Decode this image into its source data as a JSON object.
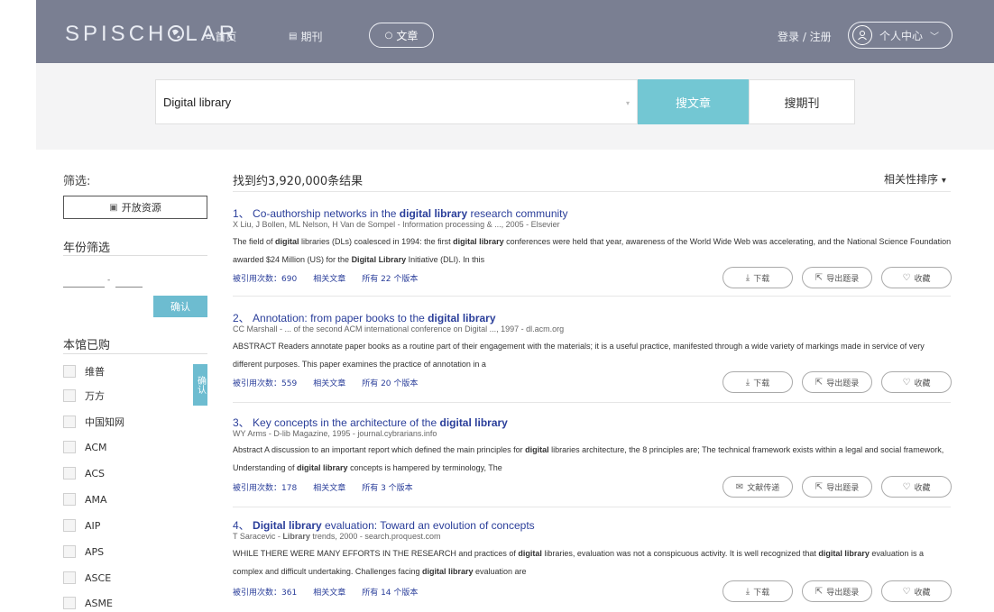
{
  "header": {
    "logo_text": "SPISCH",
    "logo_text_after": "LAR",
    "nav": [
      {
        "icon": "home-icon",
        "label": "首页"
      },
      {
        "icon": "journal-icon",
        "label": "期刊"
      }
    ],
    "search_tab": "文章",
    "login_register": "登录 / 注册",
    "user_center": "个人中心"
  },
  "search": {
    "value": "Digital library",
    "btn_article": "搜文章",
    "btn_journal": "搜期刊"
  },
  "sidebar": {
    "filter_title": "筛选:",
    "open_resources": "开放资源",
    "year_filter_title": "年份筛选",
    "year_dash": "-",
    "confirm": "确认",
    "library_title": "本馆已购",
    "library_confirm": "确认",
    "libraries": [
      "维普",
      "万方",
      "中国知网",
      "ACM",
      "ACS",
      "AMA",
      "AIP",
      "APS",
      "ASCE",
      "ASME"
    ]
  },
  "results": {
    "count": "找到约3,920,000条结果",
    "sort": "相关性排序",
    "items": [
      {
        "num": "1、",
        "title_pre": "Co-authorship networks in the ",
        "title_bold": "digital library",
        "title_post": " research community",
        "authors": "X Liu, J Bollen, ML Nelson, H Van de Sompel - Information processing & ..., 2005 - Elsevier",
        "abstract": "The field of <b>digital</b> libraries (DLs) coalesced in 1994: the first <b>digital library</b> conferences were held that year, awareness of the World Wide Web was accelerating, and the National Science Foundation awarded $24 Million (US) for the <b>Digital Library</b> Initiative (DLI). In this",
        "cited": "被引用次数：690",
        "related": "相关文章",
        "versions": "所有 22 个版本",
        "action1": "下载",
        "action1_icon": "download-icon",
        "action2": "导出题录",
        "action3": "收藏"
      },
      {
        "num": "2、",
        "title_pre": "Annotation: from paper books to the ",
        "title_bold": "digital library",
        "title_post": "",
        "authors": "CC Marshall - ... of the second ACM international conference on Digital ..., 1997 - dl.acm.org",
        "abstract": "ABSTRACT Readers annotate paper books as a routine part of their engagement with the materials; it is a useful practice, manifested through a wide variety of markings made in service of very different purposes. This paper examines the practice of annotation in a",
        "cited": "被引用次数：559",
        "related": "相关文章",
        "versions": "所有 20 个版本",
        "action1": "下载",
        "action1_icon": "download-icon",
        "action2": "导出题录",
        "action3": "收藏"
      },
      {
        "num": "3、",
        "title_pre": "Key concepts in the architecture of the ",
        "title_bold": "digital library",
        "title_post": "",
        "authors": "WY Arms - D-lib Magazine, 1995 - journal.cybrarians.info",
        "abstract": "Abstract A discussion to an important report which defined the main principles for <b>digital</b> libraries architecture, the 8 principles are; The technical framework exists within a legal and social framework, Understanding of <b>digital library</b> concepts is hampered by terminology, The",
        "cited": "被引用次数：178",
        "related": "相关文章",
        "versions": "所有 3 个版本",
        "action1": "文献传递",
        "action1_icon": "document-delivery-icon",
        "action2": "导出题录",
        "action3": "收藏"
      },
      {
        "num": "4、",
        "title_pre": "",
        "title_bold": "Digital library",
        "title_post": " evaluation: Toward an evolution of concepts",
        "authors": "T Saracevic - <b>Library</b> trends, 2000 - search.proquest.com",
        "abstract": "WHILE THERE WERE MANY EFFORTS IN THE RESEARCH and practices of <b>digital</b> libraries, evaluation was not a conspicuous activity. It is well recognized that <b>digital library</b> evaluation is a complex and difficult undertaking. Challenges facing <b>digital library</b> evaluation are",
        "cited": "被引用次数：361",
        "related": "相关文章",
        "versions": "所有 14 个版本",
        "action1": "下载",
        "action1_icon": "download-icon",
        "action2": "导出题录",
        "action3": "收藏"
      }
    ]
  }
}
